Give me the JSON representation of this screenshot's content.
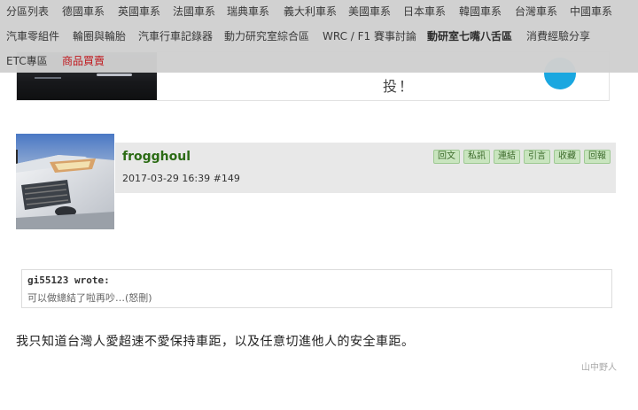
{
  "nav": {
    "row1": [
      "分區列表",
      "德國車系",
      "英國車系",
      "法國車系",
      "瑞典車系",
      "義大利車系",
      "美國車系",
      "日本車系",
      "韓國車系",
      "台灣車系",
      "中國車系"
    ],
    "row2": [
      "汽車零組件",
      "輪圈與輪胎",
      "汽車行車記錄器",
      "動力研究室綜合區",
      "WRC / F1 賽事討論",
      "動研室七嘴八舌區",
      "消費經驗分享"
    ],
    "row3": [
      "ETC專區",
      "商品買賣"
    ]
  },
  "ad": {
    "cta_text": "投！"
  },
  "post": {
    "username": "frogghoul",
    "datetime": "2017-03-29 16:39",
    "post_number": "#149",
    "actions": [
      "回文",
      "私訊",
      "連結",
      "引言",
      "收藏",
      "回報"
    ]
  },
  "quote": {
    "author": "gi55123 wrote:",
    "text": "可以做總結了啦再吵…(怒刪)"
  },
  "content": {
    "body": "我只知道台灣人愛超速不愛保持車距，以及任意切進他人的安全車距。",
    "signature": "山中野人"
  },
  "colors": {
    "nav_bg": "#d0d0d0",
    "username": "#2b6b14",
    "action_bg": "#c9e5bf",
    "red_link": "#c0151b"
  }
}
